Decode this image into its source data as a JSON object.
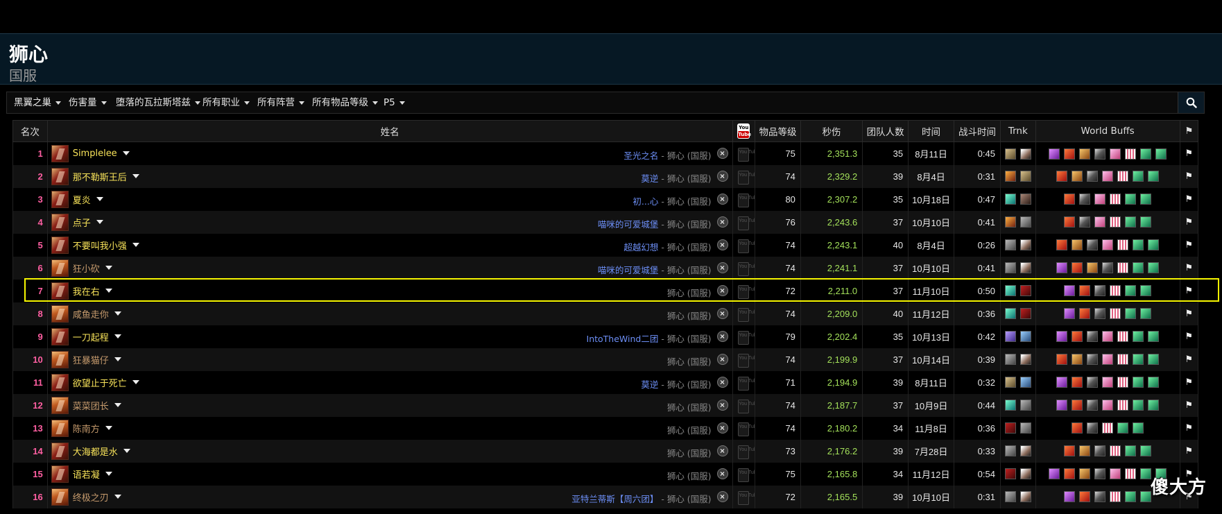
{
  "page": {
    "title": "狮心",
    "subtitle": "国服"
  },
  "filters": [
    {
      "label": "黑翼之巢"
    },
    {
      "label": "伤害量"
    },
    {
      "label": "堕落的瓦拉斯塔兹"
    },
    {
      "label": "所有职业"
    },
    {
      "label": "所有阵营"
    },
    {
      "label": "所有物品等级"
    },
    {
      "label": "P5"
    }
  ],
  "table": {
    "headers": {
      "rank": "名次",
      "name": "姓名",
      "youtube": "You Tube",
      "item_level": "物品等级",
      "dps": "秒伤",
      "raid_size": "团队人数",
      "time": "时间",
      "duration": "战斗时间",
      "trnk": "Trnk",
      "world_buffs": "World Buffs"
    },
    "realm_suffix": "狮心 (国服)",
    "rows": [
      {
        "rank": "1",
        "name": "Simplelee",
        "cls": "rogue",
        "guild": "圣光之名",
        "ilvl": "75",
        "dps": "2,351.3",
        "size": "35",
        "date": "8月11日",
        "dur": "0:45",
        "trnk": [
          "sand",
          "feather"
        ],
        "wb": [
          "purple",
          "red",
          "orange",
          "claw",
          "pink",
          "rays",
          "green",
          "green"
        ]
      },
      {
        "rank": "2",
        "name": "那不勒斯王后",
        "cls": "rogue",
        "guild": "莫逆",
        "ilvl": "74",
        "dps": "2,329.2",
        "size": "39",
        "date": "8月4日",
        "dur": "0:31",
        "trnk": [
          "ember",
          "sand"
        ],
        "wb": [
          "red",
          "orange",
          "claw",
          "pink",
          "rays",
          "green",
          "green"
        ]
      },
      {
        "rank": "3",
        "name": "夏炎",
        "cls": "rogue",
        "guild": "初...心",
        "ilvl": "80",
        "dps": "2,307.2",
        "size": "35",
        "date": "10月18日",
        "dur": "0:47",
        "trnk": [
          "teal",
          "dark"
        ],
        "wb": [
          "red",
          "claw",
          "pink",
          "rays",
          "green",
          "green"
        ]
      },
      {
        "rank": "4",
        "name": "点子",
        "cls": "rogue",
        "guild": "喵咪的可爱城堡",
        "ilvl": "76",
        "dps": "2,243.6",
        "size": "37",
        "date": "10月10日",
        "dur": "0:41",
        "trnk": [
          "ember",
          "gray"
        ],
        "wb": [
          "red",
          "claw",
          "pink",
          "rays",
          "green",
          "green"
        ]
      },
      {
        "rank": "5",
        "name": "不要叫我小强",
        "cls": "rogue",
        "guild": "超越幻想",
        "ilvl": "74",
        "dps": "2,243.1",
        "size": "40",
        "date": "8月4日",
        "dur": "0:26",
        "trnk": [
          "gray",
          "feather"
        ],
        "wb": [
          "red",
          "orange",
          "claw",
          "pink",
          "rays",
          "green",
          "green"
        ]
      },
      {
        "rank": "6",
        "name": "狂小砍",
        "cls": "warrior",
        "guild": "喵咪的可爱城堡",
        "ilvl": "74",
        "dps": "2,241.1",
        "size": "37",
        "date": "10月10日",
        "dur": "0:41",
        "trnk": [
          "gray",
          "feather"
        ],
        "wb": [
          "purple",
          "red",
          "orange",
          "claw",
          "rays",
          "green",
          "green"
        ]
      },
      {
        "rank": "7",
        "name": "我在右",
        "cls": "rogue",
        "guild": "",
        "ilvl": "72",
        "dps": "2,211.0",
        "size": "37",
        "date": "11月10日",
        "dur": "0:50",
        "trnk": [
          "teal",
          "crimson"
        ],
        "wb": [
          "purple",
          "red",
          "claw",
          "rays",
          "green",
          "green"
        ]
      },
      {
        "rank": "8",
        "name": "咸鱼走你",
        "cls": "warrior",
        "guild": "",
        "ilvl": "74",
        "dps": "2,209.0",
        "size": "40",
        "date": "11月12日",
        "dur": "0:36",
        "trnk": [
          "teal",
          "crimson"
        ],
        "wb": [
          "purple",
          "red",
          "claw",
          "rays",
          "green",
          "green"
        ]
      },
      {
        "rank": "9",
        "name": "一刀起程",
        "cls": "rogue",
        "guild": "IntoTheWind二团",
        "ilvl": "79",
        "dps": "2,202.4",
        "size": "35",
        "date": "10月13日",
        "dur": "0:42",
        "trnk": [
          "violet",
          "blue"
        ],
        "wb": [
          "purple",
          "red",
          "claw",
          "pink",
          "rays",
          "green",
          "green"
        ]
      },
      {
        "rank": "10",
        "name": "狂暴猫仔",
        "cls": "warrior",
        "guild": "",
        "ilvl": "74",
        "dps": "2,199.9",
        "size": "37",
        "date": "10月14日",
        "dur": "0:39",
        "trnk": [
          "gray",
          "feather"
        ],
        "wb": [
          "red",
          "orange",
          "claw",
          "pink",
          "rays",
          "green",
          "green"
        ]
      },
      {
        "rank": "11",
        "name": "欲望止于死亡",
        "cls": "rogue",
        "guild": "莫逆",
        "ilvl": "71",
        "dps": "2,194.9",
        "size": "39",
        "date": "8月11日",
        "dur": "0:32",
        "trnk": [
          "sand",
          "blue"
        ],
        "wb": [
          "purple",
          "red",
          "claw",
          "pink",
          "rays",
          "green",
          "green"
        ]
      },
      {
        "rank": "12",
        "name": "菜菜团长",
        "cls": "warrior",
        "guild": "",
        "ilvl": "74",
        "dps": "2,187.7",
        "size": "37",
        "date": "10月9日",
        "dur": "0:44",
        "trnk": [
          "teal",
          "gray"
        ],
        "wb": [
          "purple",
          "red",
          "claw",
          "pink",
          "rays",
          "green",
          "green"
        ]
      },
      {
        "rank": "13",
        "name": "陈南方",
        "cls": "warrior",
        "guild": "",
        "ilvl": "74",
        "dps": "2,180.2",
        "size": "34",
        "date": "11月8日",
        "dur": "0:36",
        "trnk": [
          "crimson",
          "gray"
        ],
        "wb": [
          "red",
          "claw",
          "rays",
          "green",
          "green"
        ]
      },
      {
        "rank": "14",
        "name": "大海都是水",
        "cls": "rogue",
        "guild": "",
        "ilvl": "73",
        "dps": "2,176.2",
        "size": "39",
        "date": "7月28日",
        "dur": "0:33",
        "trnk": [
          "gray",
          "feather"
        ],
        "wb": [
          "red",
          "orange",
          "claw",
          "rays",
          "green",
          "green"
        ]
      },
      {
        "rank": "15",
        "name": "语若凝",
        "cls": "rogue",
        "guild": "",
        "ilvl": "75",
        "dps": "2,165.8",
        "size": "34",
        "date": "11月12日",
        "dur": "0:54",
        "trnk": [
          "crimson",
          "feather"
        ],
        "wb": [
          "purple",
          "red",
          "orange",
          "claw",
          "pink",
          "rays",
          "green",
          "green"
        ]
      },
      {
        "rank": "16",
        "name": "终极之刃",
        "cls": "warrior",
        "guild": "亚特兰蒂斯【周六团】",
        "ilvl": "72",
        "dps": "2,165.5",
        "size": "39",
        "date": "10月10日",
        "dur": "0:31",
        "trnk": [
          "gray",
          "feather"
        ],
        "wb": [
          "purple",
          "red",
          "claw",
          "rays",
          "green",
          "green"
        ]
      }
    ]
  },
  "watermark": "傻大方"
}
